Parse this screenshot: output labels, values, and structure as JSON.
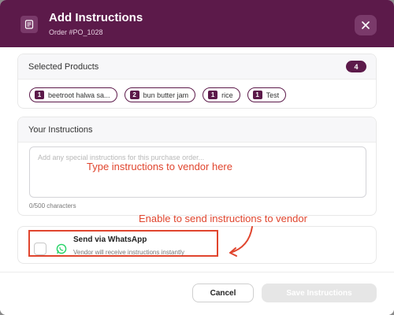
{
  "header": {
    "title": "Add Instructions",
    "subtitle": "Order #PO_1028"
  },
  "selected_products": {
    "title": "Selected Products",
    "count": "4",
    "items": [
      {
        "qty": "1",
        "name": "beetroot halwa sa..."
      },
      {
        "qty": "2",
        "name": "bun butter jam"
      },
      {
        "qty": "1",
        "name": "rice"
      },
      {
        "qty": "1",
        "name": "Test"
      }
    ]
  },
  "instructions": {
    "title": "Your Instructions",
    "placeholder": "Add any special instructions for this purchase order...",
    "char_count": "0/500 characters"
  },
  "whatsapp": {
    "title": "Send via WhatsApp",
    "subtitle": "Vendor will receive instructions instantly",
    "checked": false
  },
  "annotations": {
    "textarea_hint": "Type instructions to vendor here",
    "whatsapp_hint": "Enable to send instructions to vendor",
    "color": "#e0452e"
  },
  "footer": {
    "cancel_label": "Cancel",
    "save_label": "Save Instructions"
  },
  "colors": {
    "brand": "#5c1a4a",
    "whatsapp": "#25d366"
  }
}
